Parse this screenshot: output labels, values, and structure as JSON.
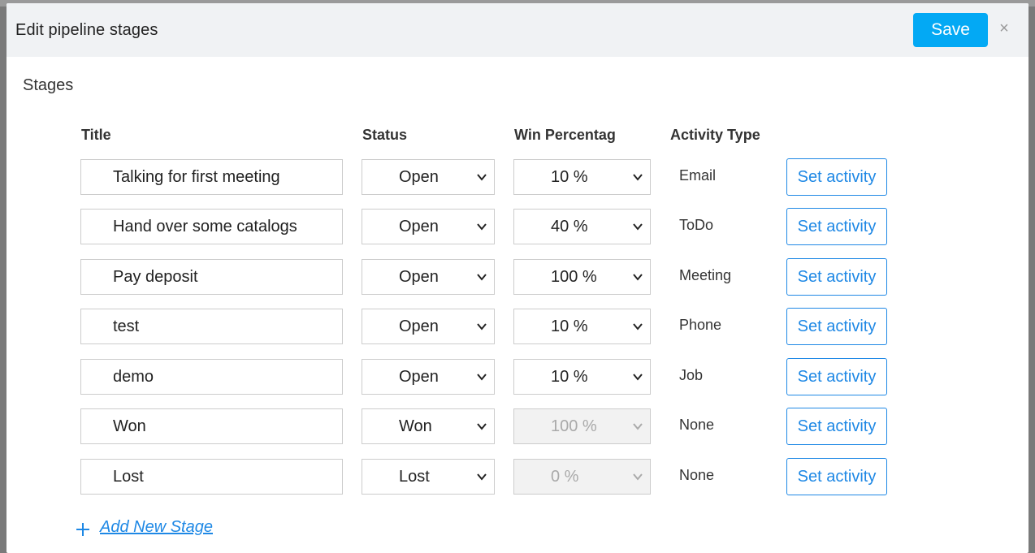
{
  "modal": {
    "title": "Edit pipeline stages",
    "save_label": "Save",
    "close_symbol": "×"
  },
  "section_title": "Stages",
  "columns": {
    "title": "Title",
    "status": "Status",
    "win": "Win Percentag",
    "activity": "Activity Type"
  },
  "stages": [
    {
      "title": "Talking for first meeting",
      "status": "Open",
      "win": "10 %",
      "win_disabled": false,
      "activity": "Email",
      "button": "Set activity"
    },
    {
      "title": "Hand over some catalogs",
      "status": "Open",
      "win": "40 %",
      "win_disabled": false,
      "activity": "ToDo",
      "button": "Set activity"
    },
    {
      "title": "Pay deposit",
      "status": "Open",
      "win": "100 %",
      "win_disabled": false,
      "activity": "Meeting",
      "button": "Set activity"
    },
    {
      "title": "test",
      "status": "Open",
      "win": "10 %",
      "win_disabled": false,
      "activity": "Phone",
      "button": "Set activity"
    },
    {
      "title": "demo",
      "status": "Open",
      "win": "10 %",
      "win_disabled": false,
      "activity": "Job",
      "button": "Set activity"
    },
    {
      "title": "Won",
      "status": "Won",
      "win": "100 %",
      "win_disabled": true,
      "activity": "None",
      "button": "Set activity"
    },
    {
      "title": "Lost",
      "status": "Lost",
      "win": "0 %",
      "win_disabled": true,
      "activity": "None",
      "button": "Set activity"
    }
  ],
  "add_stage_label": "Add New Stage",
  "icons": {
    "close": "close-icon",
    "chevron": "chevron-down-icon",
    "add": "plus-icon"
  },
  "colors": {
    "primary": "#03a9f4",
    "link": "#1e88e5",
    "header_bg": "#f0f2f4"
  }
}
